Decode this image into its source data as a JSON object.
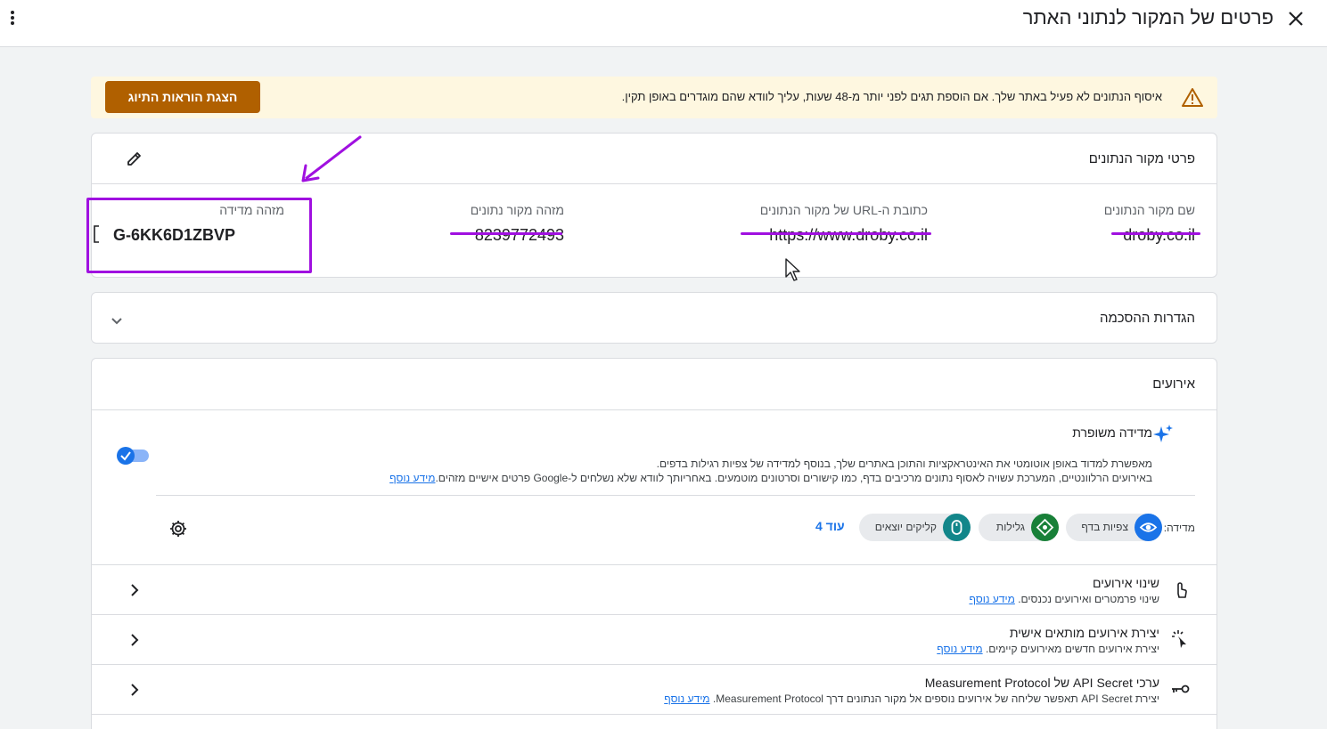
{
  "header": {
    "title": "פרטים של המקור לנתוני האתר",
    "close_icon": "close-icon",
    "menu_icon": "more-vert-icon"
  },
  "banner": {
    "text": "איסוף הנתונים לא פעיל באתר שלך. אם הוספת תגים לפני יותר מ-48 שעות, עליך לוודא שהם מוגדרים באופן תקין.",
    "button": "הצגת הוראות התיוג",
    "icon": "warning-icon"
  },
  "details": {
    "heading": "פרטי מקור הנתונים",
    "edit_icon": "edit-icon",
    "fields": [
      {
        "label": "שם מקור הנתונים",
        "value": "droby.co.il"
      },
      {
        "label": "כתובת ה-URL של מקור הנתונים",
        "value": "https://www.droby.co.il"
      },
      {
        "label": "מזהה מקור נתונים",
        "value": "8239772493"
      },
      {
        "label": "מזהה מדידה",
        "value": "G-6KK6D1ZBVP"
      }
    ],
    "copy_icon": "copy-icon"
  },
  "consent": {
    "heading": "הגדרות ההסכמה",
    "chevron_icon": "chevron-down-icon"
  },
  "events": {
    "heading": "אירועים",
    "enhanced": {
      "title": "מדידה משופרת",
      "desc1": "מאפשרת למדוד באופן אוטומטי את האינטראקציות והתוכן באתרים שלך, בנוסף למדידה של צפיות רגילות בדפים.",
      "desc2": "באירועים הרלוונטיים, המערכת עשויה לאסוף נתונים מרכיבים בדף, כמו קישורים וסרטונים מוטמעים. באחריותך לוודא שלא נשלחים ל-Google פרטים אישיים מזהים.",
      "learn_more": "מידע נוסף",
      "toggle_on": true,
      "measuring_label": "מדידה:",
      "chips": [
        {
          "label": "צפיות בדף",
          "icon": "eye-icon",
          "color": "#1a73e8"
        },
        {
          "label": "גלילות",
          "icon": "scroll-arrows-icon",
          "color": "#188038"
        },
        {
          "label": "קליקים יוצאים",
          "icon": "mouse-icon",
          "color": "#12868a"
        }
      ],
      "more": "עוד 4",
      "settings_icon": "gear-icon"
    },
    "rows": [
      {
        "title": "שינוי אירועים",
        "desc": "שינוי פרמטרים ואירועים נכנסים.",
        "link": "מידע נוסף",
        "icon": "touch-icon"
      },
      {
        "title": "יצירת אירועים מותאים אישית",
        "desc": "יצירת אירועים חדשים מאירועים קיימים.",
        "link": "מידע נוסף",
        "icon": "cursor-click-icon"
      },
      {
        "title": "ערכי API Secret של Measurement Protocol",
        "desc": "יצירת API Secret תאפשר שליחה של אירועים נוספים אל מקור הנתונים דרך Measurement Protocol.",
        "link": "מידע נוסף",
        "icon": "key-icon"
      }
    ]
  },
  "colors": {
    "annotation": "#a010e0",
    "warning_button": "#b06000",
    "primary": "#1a73e8"
  }
}
